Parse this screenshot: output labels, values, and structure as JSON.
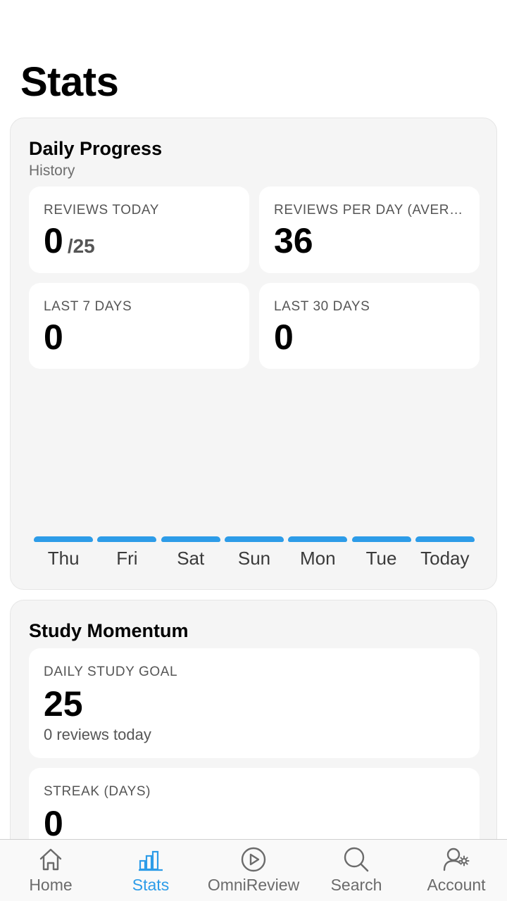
{
  "page": {
    "title": "Stats"
  },
  "daily_progress": {
    "title": "Daily Progress",
    "subtitle": "History",
    "tiles": [
      {
        "label": "REVIEWS TODAY",
        "value": "0",
        "unit": "/25"
      },
      {
        "label": "REVIEWS PER DAY (AVERAGE)",
        "value": "36"
      },
      {
        "label": "LAST 7 DAYS",
        "value": "0"
      },
      {
        "label": "LAST 30 DAYS",
        "value": "0"
      }
    ],
    "history_chart": {
      "type": "bar",
      "categories": [
        "Thu",
        "Fri",
        "Sat",
        "Sun",
        "Mon",
        "Tue",
        "Today"
      ],
      "values": [
        0,
        0,
        0,
        0,
        0,
        0,
        0
      ],
      "bar_color": "#2d9ce8"
    }
  },
  "study_momentum": {
    "title": "Study Momentum",
    "tiles": [
      {
        "label": "DAILY STUDY GOAL",
        "value": "25",
        "note": "0 reviews today"
      },
      {
        "label": "STREAK (DAYS)",
        "value": "0"
      }
    ]
  },
  "tabbar": {
    "active_color": "#2d9ce8",
    "inactive_color": "#6b6b6b",
    "items": [
      {
        "label": "Home",
        "icon": "home-icon",
        "active": false
      },
      {
        "label": "Stats",
        "icon": "stats-icon",
        "active": true
      },
      {
        "label": "OmniReview",
        "icon": "play-circle-icon",
        "active": false
      },
      {
        "label": "Search",
        "icon": "search-icon",
        "active": false
      },
      {
        "label": "Account",
        "icon": "account-settings-icon",
        "active": false
      }
    ]
  }
}
